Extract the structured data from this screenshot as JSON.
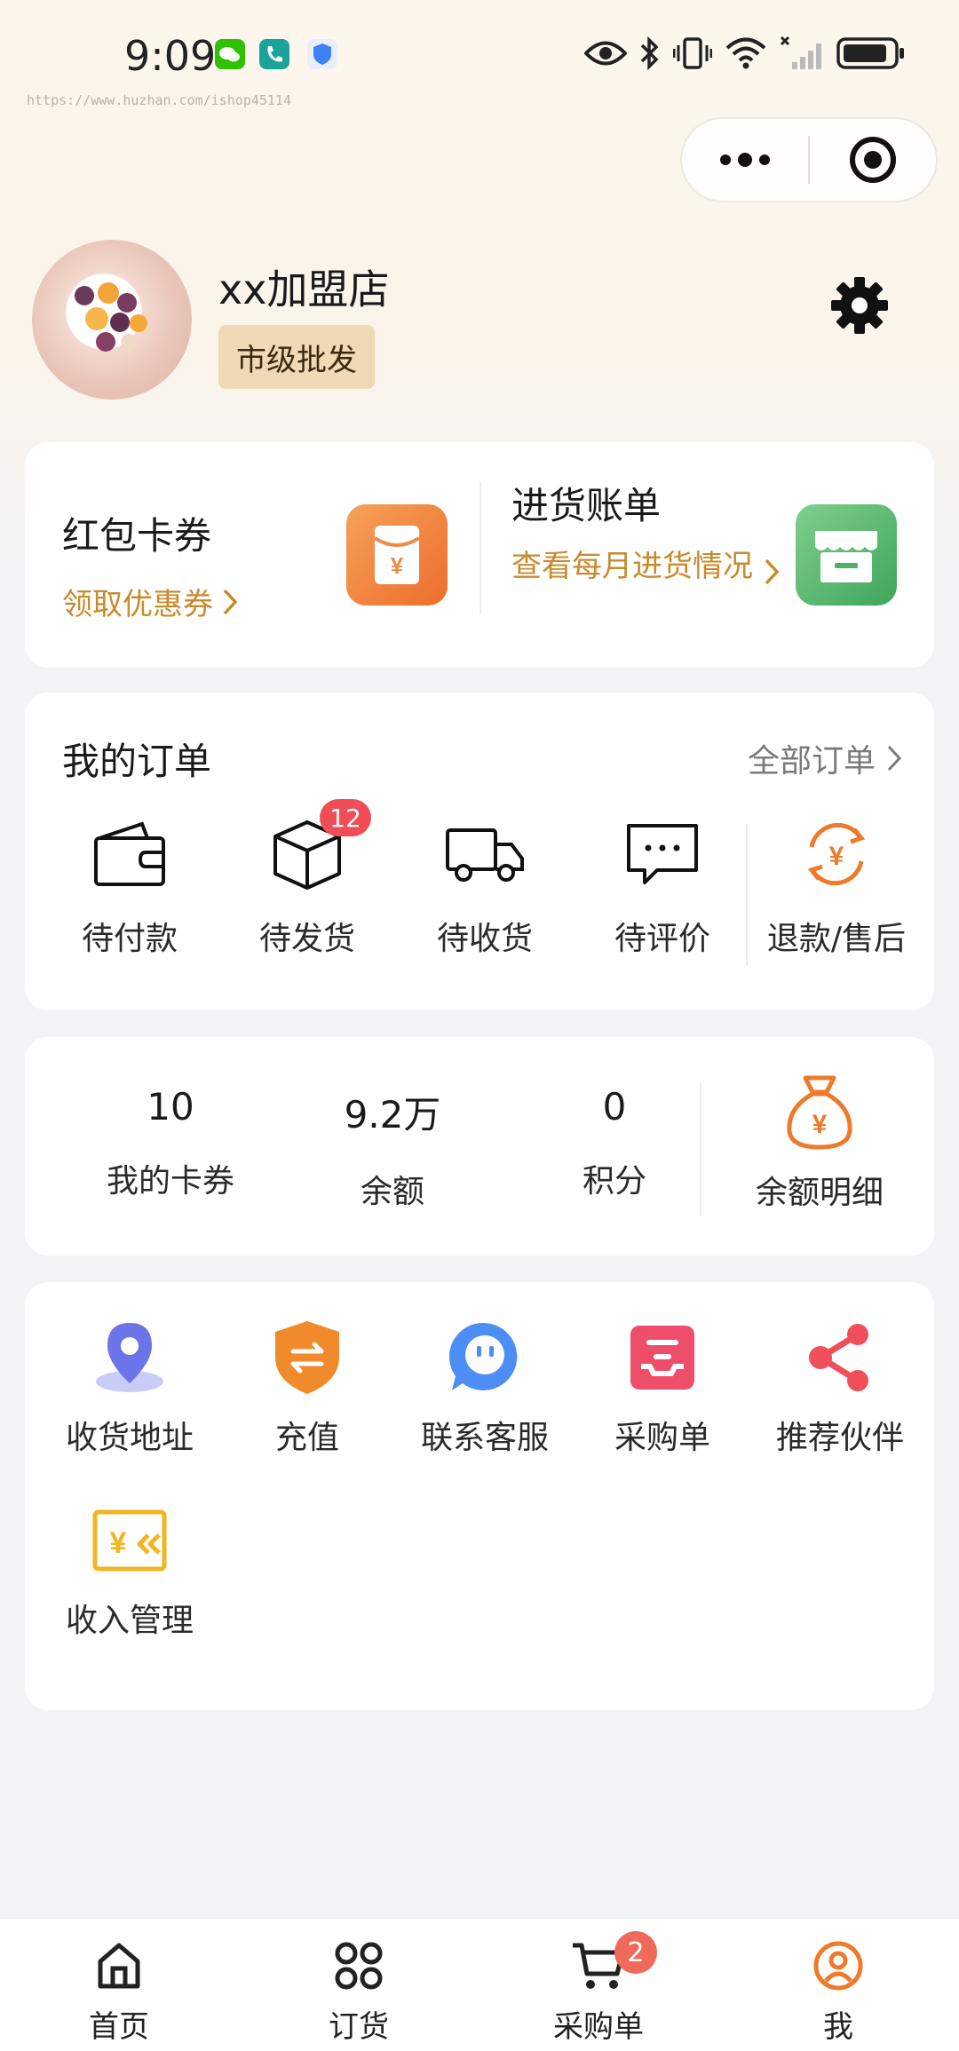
{
  "status_bar": {
    "time": "9:09",
    "watermark": "https://www.huzhan.com/ishop45114",
    "icons": [
      "wechat-icon",
      "phone-icon",
      "shield-icon",
      "eye-icon",
      "bluetooth-icon",
      "vibrate-icon",
      "wifi-icon",
      "signal-icon",
      "battery-icon"
    ]
  },
  "capsule": {
    "more_icon": "more-dots-icon",
    "close_icon": "target-close-icon"
  },
  "profile": {
    "store_name": "xx加盟店",
    "tag": "市级批发",
    "settings_icon": "gear-icon"
  },
  "promo": {
    "coupon": {
      "title": "红包卡券",
      "link": "领取优惠券",
      "icon": "red-envelope-icon",
      "color": "#ee6d2c"
    },
    "bill": {
      "title": "进货账单",
      "link": "查看每月进货情况",
      "icon": "store-icon",
      "color": "#3fa55a"
    }
  },
  "orders": {
    "title": "我的订单",
    "all_link": "全部订单",
    "items": [
      {
        "label": "待付款",
        "icon": "wallet-icon"
      },
      {
        "label": "待发货",
        "icon": "package-icon",
        "badge": "12"
      },
      {
        "label": "待收货",
        "icon": "truck-icon"
      },
      {
        "label": "待评价",
        "icon": "comment-icon"
      },
      {
        "label": "退款/售后",
        "icon": "refund-icon"
      }
    ]
  },
  "assets": {
    "items": [
      {
        "value": "10",
        "label": "我的卡券"
      },
      {
        "value": "9.2万",
        "label": "余额"
      },
      {
        "value": "0",
        "label": "积分"
      }
    ],
    "detail": {
      "label": "余额明细",
      "icon": "money-bag-icon"
    }
  },
  "services": [
    {
      "label": "收货地址",
      "icon": "location-pin-icon",
      "color": "#6b74e8"
    },
    {
      "label": "充值",
      "icon": "recharge-shield-icon",
      "color": "#f08a2a"
    },
    {
      "label": "联系客服",
      "icon": "chat-bubble-icon",
      "color": "#4c8df6"
    },
    {
      "label": "采购单",
      "icon": "purchase-list-icon",
      "color": "#ef4e6a"
    },
    {
      "label": "推荐伙伴",
      "icon": "share-icon",
      "color": "#ef4e5a"
    },
    {
      "label": "收入管理",
      "icon": "income-icon",
      "color": "#f3b520"
    }
  ],
  "tabbar": [
    {
      "label": "首页",
      "icon": "home-icon"
    },
    {
      "label": "订货",
      "icon": "grid-dots-icon"
    },
    {
      "label": "采购单",
      "icon": "cart-icon",
      "badge": "2"
    },
    {
      "label": "我",
      "icon": "user-circle-icon",
      "active": true
    }
  ],
  "accent_color": "#ee7a2a"
}
